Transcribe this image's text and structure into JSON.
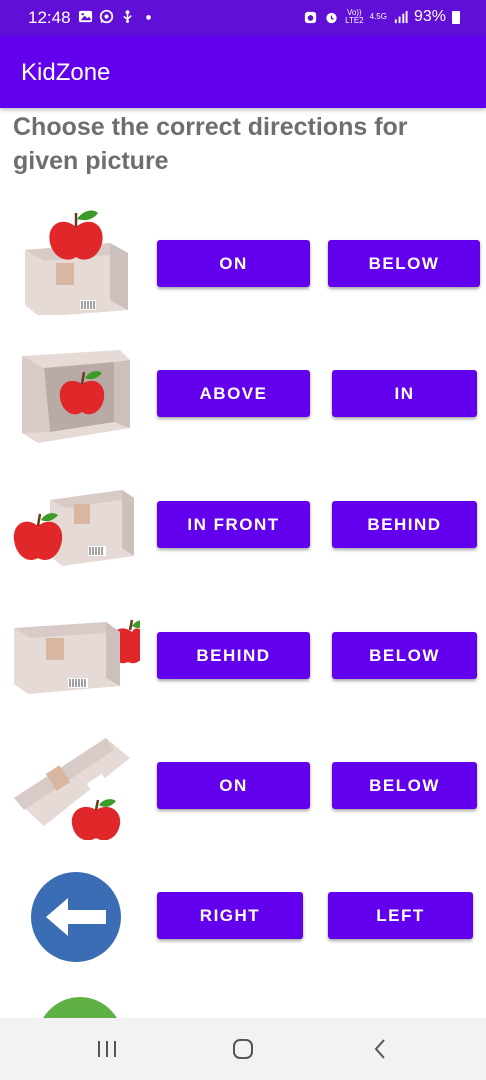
{
  "status_bar": {
    "time": "12:48",
    "network_top": "Vo))",
    "network_bottom": "LTE2",
    "network_gen": "4.5G",
    "battery": "93%"
  },
  "app": {
    "title": "KidZone"
  },
  "question": "Choose the correct directions for given picture",
  "rows": [
    {
      "image": "apple-on-box",
      "options": [
        "ON",
        "BELOW"
      ]
    },
    {
      "image": "apple-in-box",
      "options": [
        "ABOVE",
        "IN"
      ]
    },
    {
      "image": "apple-in-front-of-box",
      "options": [
        "IN FRONT",
        "BEHIND"
      ]
    },
    {
      "image": "apple-behind-box",
      "options": [
        "BEHIND",
        "BELOW"
      ]
    },
    {
      "image": "apple-below-box",
      "options": [
        "ON",
        "BELOW"
      ]
    },
    {
      "image": "left-arrow-circle",
      "options": [
        "RIGHT",
        "LEFT"
      ]
    }
  ],
  "colors": {
    "primary": "#6200ee",
    "status_bar": "#5f0fd6",
    "question_text": "#6e6e6e",
    "arrow_circle": "#3b6db5",
    "apple": "#e0282a",
    "box": "#e6dad6"
  }
}
